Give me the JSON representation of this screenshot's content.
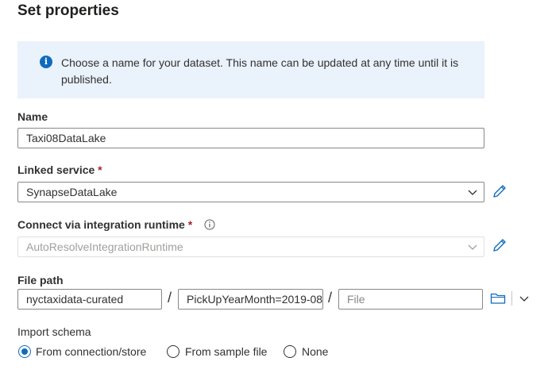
{
  "title": "Set properties",
  "info": {
    "text": "Choose a name for your dataset. This name can be updated at any time until it is published.",
    "icon": "info-icon"
  },
  "name": {
    "label": "Name",
    "value": "Taxi08DataLake"
  },
  "linked_service": {
    "label": "Linked service",
    "required": "*",
    "value": "SynapseDataLake"
  },
  "runtime": {
    "label": "Connect via integration runtime",
    "required": "*",
    "value": "AutoResolveIntegrationRuntime"
  },
  "file_path": {
    "label": "File path",
    "container": "nyctaxidata-curated",
    "directory": "PickUpYearMonth=2019-08",
    "file_placeholder": "File",
    "separator": "/"
  },
  "import_schema": {
    "label": "Import schema",
    "options": [
      {
        "label": "From connection/store",
        "selected": true
      },
      {
        "label": "From sample file",
        "selected": false
      },
      {
        "label": "None",
        "selected": false
      }
    ]
  },
  "colors": {
    "accent": "#0f6cbd",
    "required": "#a4262c",
    "info_bg": "#eaf2fb"
  }
}
